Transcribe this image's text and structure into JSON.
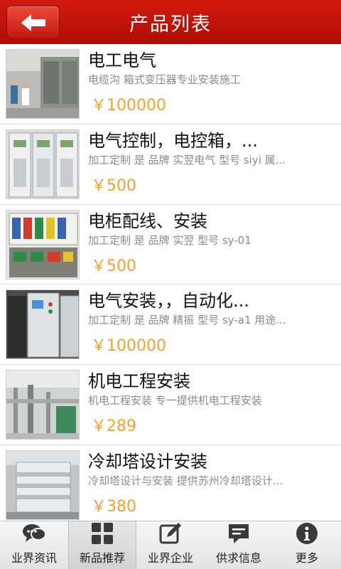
{
  "header": {
    "title": "产品列表",
    "back_icon": "arrow-left-icon"
  },
  "products": [
    {
      "title": "电工电气",
      "desc": "电缆沟 箱式变压器专业安装施工",
      "price": "￥100000",
      "thumb": "transformer-site-photo"
    },
    {
      "title": "电气控制，电控箱，...",
      "desc": "加工定制 是 品牌 实翌电气 型号 siyi 属...",
      "price": "￥500",
      "thumb": "control-cabinet-photo"
    },
    {
      "title": "电柜配线、安装",
      "desc": "加工定制 是 品牌 实翌 型号 sy-01",
      "price": "￥500",
      "thumb": "wiring-cabinet-photo"
    },
    {
      "title": "电气安装，，自动化...",
      "desc": "加工定制 是 品牌 精振 型号 sy-a1 用途...",
      "price": "￥100000",
      "thumb": "automation-cabinet-photo"
    },
    {
      "title": "机电工程安装",
      "desc": "机电工程安装 专一提供机电工程安装",
      "price": "￥289",
      "thumb": "plant-installation-photo"
    },
    {
      "title": "冷却塔设计安装",
      "desc": "冷却塔设计与安装 提供苏州冷却塔设计...",
      "price": "￥380",
      "thumb": "cooling-tower-photo"
    }
  ],
  "tabs": [
    {
      "label": "业界资讯",
      "icon": "chat-bubbles-icon",
      "active": false
    },
    {
      "label": "新品推荐",
      "icon": "grid-icon",
      "active": true
    },
    {
      "label": "业界企业",
      "icon": "edit-icon",
      "active": false
    },
    {
      "label": "供求信息",
      "icon": "message-icon",
      "active": false
    },
    {
      "label": "更多",
      "icon": "info-icon",
      "active": false
    }
  ],
  "colors": {
    "header": "#c4130a",
    "price": "#f4a12a",
    "title": "#111111",
    "desc": "#8a8a8a"
  }
}
